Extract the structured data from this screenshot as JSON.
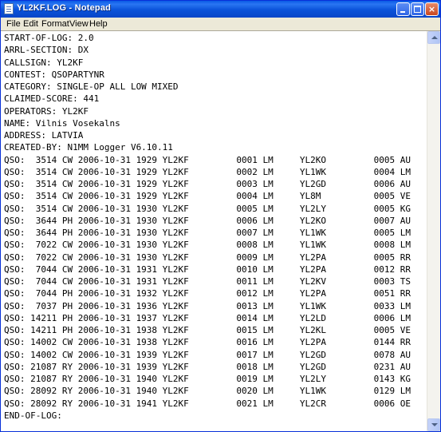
{
  "window": {
    "title": "YL2KF.LOG - Notepad",
    "controls": {
      "minimize": "minimize",
      "maximize": "maximize",
      "close": "×"
    }
  },
  "menu": [
    "File",
    "Edit",
    "Format",
    "View",
    "Help"
  ],
  "document": {
    "lines": [
      "START-OF-LOG: 2.0",
      "ARRL-SECTION: DX",
      "CALLSIGN: YL2KF",
      "CONTEST: QSOPARTYNR",
      "CATEGORY: SINGLE-OP ALL LOW MIXED",
      "CLAIMED-SCORE: 441",
      "OPERATORS: YL2KF",
      "NAME: Vilnis Vosekalns",
      "ADDRESS: LATVIA",
      "CREATED-BY: N1MM Logger V6.10.11",
      "QSO:  3514 CW 2006-10-31 1929 YL2KF         0001 LM     YL2KO         0005 AU",
      "QSO:  3514 CW 2006-10-31 1929 YL2KF         0002 LM     YL1WK         0004 LM",
      "QSO:  3514 CW 2006-10-31 1929 YL2KF         0003 LM     YL2GD         0006 AU",
      "QSO:  3514 CW 2006-10-31 1929 YL2KF         0004 LM     YL8M          0005 VE",
      "QSO:  3514 CW 2006-10-31 1930 YL2KF         0005 LM     YL2LY         0005 KG",
      "QSO:  3644 PH 2006-10-31 1930 YL2KF         0006 LM     YL2KO         0007 AU",
      "QSO:  3644 PH 2006-10-31 1930 YL2KF         0007 LM     YL1WK         0005 LM",
      "QSO:  7022 CW 2006-10-31 1930 YL2KF         0008 LM     YL1WK         0008 LM",
      "QSO:  7022 CW 2006-10-31 1930 YL2KF         0009 LM     YL2PA         0005 RR",
      "QSO:  7044 CW 2006-10-31 1931 YL2KF         0010 LM     YL2PA         0012 RR",
      "QSO:  7044 CW 2006-10-31 1931 YL2KF         0011 LM     YL2KV         0003 TS",
      "QSO:  7044 PH 2006-10-31 1932 YL2KF         0012 LM     YL2PA         0051 RR",
      "QSO:  7037 PH 2006-10-31 1936 YL2KF         0013 LM     YL1WK         0033 LM",
      "QSO: 14211 PH 2006-10-31 1937 YL2KF         0014 LM     YL2LD         0006 LM",
      "QSO: 14211 PH 2006-10-31 1938 YL2KF         0015 LM     YL2KL         0005 VE",
      "QSO: 14002 CW 2006-10-31 1938 YL2KF         0016 LM     YL2PA         0144 RR",
      "QSO: 14002 CW 2006-10-31 1939 YL2KF         0017 LM     YL2GD         0078 AU",
      "QSO: 21087 RY 2006-10-31 1939 YL2KF         0018 LM     YL2GD         0231 AU",
      "QSO: 21087 RY 2006-10-31 1940 YL2KF         0019 LM     YL2LY         0143 KG",
      "QSO: 28092 RY 2006-10-31 1940 YL2KF         0020 LM     YL1WK         0129 LM",
      "QSO: 28092 RY 2006-10-31 1941 YL2KF         0021 LM     YL2CR         0006 OE",
      "END-OF-LOG:"
    ]
  },
  "colors": {
    "titlebar": "#0a52d9",
    "close_button": "#c9471f",
    "chrome": "#ece9d8",
    "text": "#000000"
  },
  "icons": {
    "app": "notepad-icon",
    "scroll_up": "scroll-up-arrow-icon",
    "scroll_down": "scroll-down-arrow-icon"
  }
}
